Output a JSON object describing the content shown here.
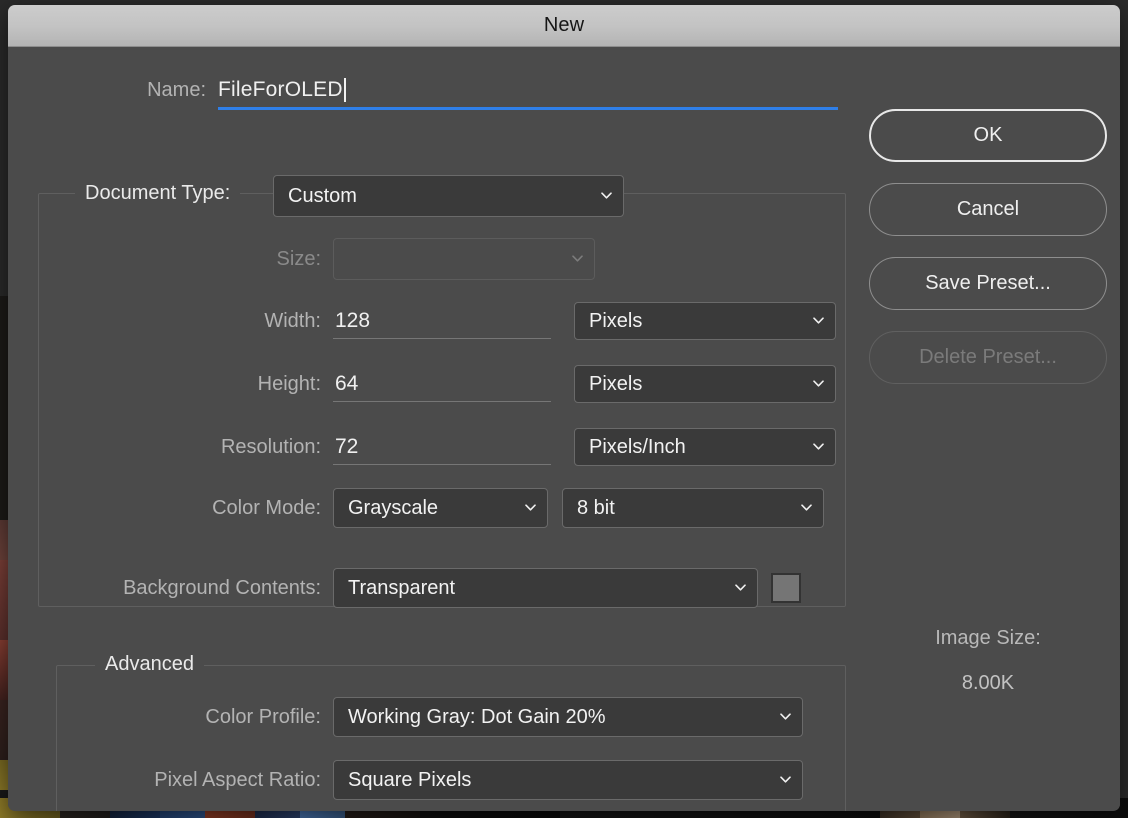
{
  "window": {
    "title": "New"
  },
  "form": {
    "name": {
      "label": "Name:",
      "value": "FileForOLED"
    },
    "document_type": {
      "label": "Document Type:",
      "value": "Custom"
    },
    "size": {
      "label": "Size:",
      "value": "",
      "placeholder": ""
    },
    "width": {
      "label": "Width:",
      "value": "128",
      "unit": "Pixels"
    },
    "height": {
      "label": "Height:",
      "value": "64",
      "unit": "Pixels"
    },
    "resolution": {
      "label": "Resolution:",
      "value": "72",
      "unit": "Pixels/Inch"
    },
    "color_mode": {
      "label": "Color Mode:",
      "value": "Grayscale",
      "depth": "8 bit"
    },
    "background_contents": {
      "label": "Background Contents:",
      "value": "Transparent",
      "swatch_color": "#757575"
    }
  },
  "advanced": {
    "title": "Advanced",
    "color_profile": {
      "label": "Color Profile:",
      "value": "Working Gray:  Dot Gain 20%"
    },
    "pixel_aspect_ratio": {
      "label": "Pixel Aspect Ratio:",
      "value": "Square Pixels"
    }
  },
  "buttons": {
    "ok": "OK",
    "cancel": "Cancel",
    "save_preset": "Save Preset...",
    "delete_preset": "Delete Preset..."
  },
  "image_size": {
    "label": "Image Size:",
    "value": "8.00K"
  },
  "colors": {
    "dialog_bg": "#4b4b4b",
    "titlebar": "#c3c3c3",
    "focus_underline": "#2f7fe8",
    "field_bg": "#3a3a3a"
  }
}
